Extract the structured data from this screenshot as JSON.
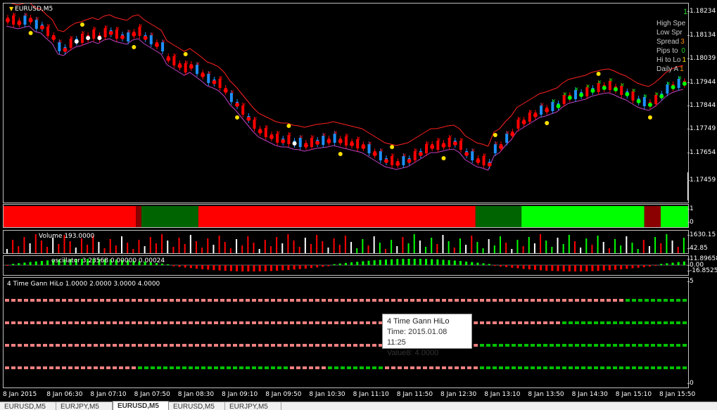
{
  "chart": {
    "title": "EURUSD,M5",
    "info_top": "12",
    "info": [
      {
        "label": "High Spe",
        "value": "",
        "color": "#c8c8c8"
      },
      {
        "label": "Low Spr",
        "value": "",
        "color": "#c8c8c8"
      },
      {
        "label": "Spread",
        "value": "3",
        "color": "#ff8c00"
      },
      {
        "label": "Pips to ",
        "value": "0",
        "color": "#24d024"
      },
      {
        "label": "Hi to Lo",
        "value": "1",
        "color": "#ffd800"
      },
      {
        "label": "Daily A",
        "value": "1",
        "color": "#ff8c00"
      }
    ],
    "price_ticks": [
      "1.18234",
      "1.18134",
      "1.18039",
      "1.17944",
      "1.17844",
      "1.17749",
      "1.17654",
      "1.17459"
    ]
  },
  "hilo_pane": {
    "ticks": [
      "1",
      "0"
    ],
    "segments": [
      {
        "from": 0.0,
        "to": 0.193,
        "color": "#ff0000"
      },
      {
        "from": 0.193,
        "to": 0.201,
        "color": "#8b0000"
      },
      {
        "from": 0.201,
        "to": 0.284,
        "color": "#006400"
      },
      {
        "from": 0.284,
        "to": 0.688,
        "color": "#ff0000"
      },
      {
        "from": 0.688,
        "to": 0.755,
        "color": "#006400"
      },
      {
        "from": 0.755,
        "to": 0.934,
        "color": "#00ff00"
      },
      {
        "from": 0.934,
        "to": 0.958,
        "color": "#8b0000"
      },
      {
        "from": 0.958,
        "to": 1.0,
        "color": "#00ff00"
      }
    ]
  },
  "volume_pane": {
    "label": "Volume 193.0000",
    "ticks": [
      "1630.15",
      "42.85"
    ]
  },
  "oscillator_pane": {
    "label": "oscillator 3.23568 0.00000 0.00024",
    "ticks": [
      "11.89658",
      "0.00",
      "-16.8525"
    ]
  },
  "gann_pane": {
    "label": "4 Time Gann HiLo 1.0000 2.0000 3.0000 4.0000",
    "ticks": [
      "5",
      "0"
    ],
    "green_from": [
      0.9,
      0.812,
      0.69,
      0.19
    ],
    "green_from_row4_pattern": true
  },
  "tooltip": {
    "title": "4 Time Gann HiLo",
    "time": "Time: 2015.01.08 11:25",
    "value": "Value8: 4.0000"
  },
  "time_axis": [
    "8 Jan 2015",
    "8 Jan 06:30",
    "8 Jan 07:10",
    "8 Jan 07:50",
    "8 Jan 08:30",
    "8 Jan 09:10",
    "8 Jan 09:50",
    "8 Jan 10:30",
    "8 Jan 11:10",
    "8 Jan 11:50",
    "8 Jan 12:30",
    "8 Jan 13:10",
    "8 Jan 13:50",
    "8 Jan 14:30",
    "8 Jan 15:10",
    "8 Jan 15:50"
  ],
  "tabs": [
    {
      "label": "EURUSD,M5",
      "active": false
    },
    {
      "label": "EURJPY,M5",
      "active": false
    },
    {
      "label": "EURUSD,M5",
      "active": true
    },
    {
      "label": "EURUSD,M5",
      "active": false
    },
    {
      "label": "EURJPY,M5",
      "active": false
    }
  ],
  "colors": {
    "bull": "#1e90ff",
    "bear": "#ff0000",
    "buy": "#00ff00",
    "neutral": "#ffffff",
    "gann_pink": "#f08080",
    "gann_green": "#00c000"
  }
}
